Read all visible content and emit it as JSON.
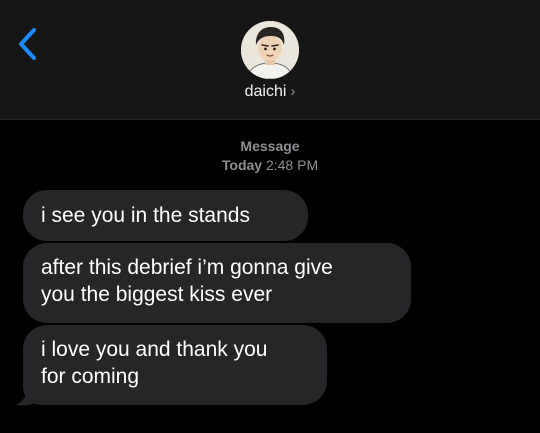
{
  "header": {
    "contact_name": "daichi",
    "contact_chevron": "›",
    "back_icon": "chevron-left-icon",
    "accent_color": "#1a8cff"
  },
  "thread": {
    "service_label": "Message",
    "timestamp_day": "Today",
    "timestamp_time": "2:48 PM"
  },
  "messages": [
    {
      "direction": "incoming",
      "text": "i see you in the stands"
    },
    {
      "direction": "incoming",
      "text": "after this debrief i’m gonna give\nyou the biggest kiss ever"
    },
    {
      "direction": "incoming",
      "text": "i love you and thank you\nfor coming"
    }
  ],
  "colors": {
    "background": "#000000",
    "header_background": "#161616",
    "incoming_bubble": "#262628",
    "secondary_text": "#8e8e93"
  }
}
